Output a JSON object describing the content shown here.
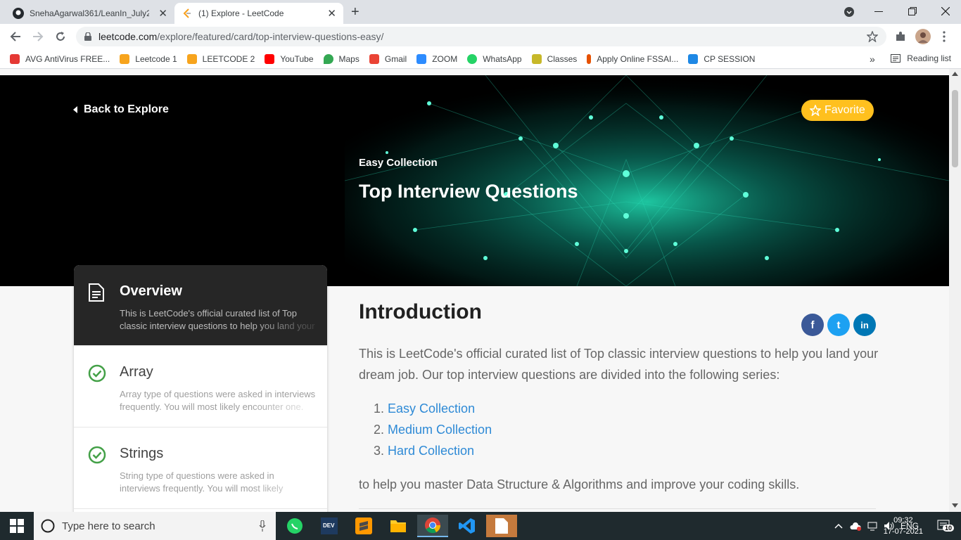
{
  "browser": {
    "tabs": [
      {
        "title": "SnehaAgarwal361/LeanIn_July20...",
        "close": "✕"
      },
      {
        "title": "(1) Explore - LeetCode",
        "close": "✕"
      }
    ],
    "new_tab": "+",
    "url_host": "leetcode.com",
    "url_path": "/explore/featured/card/top-interview-questions-easy/",
    "bookmarks": [
      {
        "label": "AVG AntiVirus FREE...",
        "color": "#e53935"
      },
      {
        "label": "Leetcode 1",
        "color": "#f7a41d"
      },
      {
        "label": "LEETCODE 2",
        "color": "#f7a41d"
      },
      {
        "label": "YouTube",
        "color": "#ff0000"
      },
      {
        "label": "Maps",
        "color": "#34a853"
      },
      {
        "label": "Gmail",
        "color": "#ea4335"
      },
      {
        "label": "ZOOM",
        "color": "#2d8cff"
      },
      {
        "label": "WhatsApp",
        "color": "#25d366"
      },
      {
        "label": "Classes",
        "color": "#c7b829"
      },
      {
        "label": "Apply Online FSSAI...",
        "color": "#e65100"
      },
      {
        "label": "CP SESSION",
        "color": "#1e88e5"
      }
    ],
    "more_bookmarks": "»",
    "reading_list": "Reading list"
  },
  "hero": {
    "back_label": "Back to Explore",
    "favorite_label": "Favorite",
    "subtitle": "Easy Collection",
    "title": "Top Interview Questions"
  },
  "chapters": [
    {
      "title": "Overview",
      "desc": "This is LeetCode's official curated list of Top classic interview questions to help you land your dream job.",
      "icon": "document-icon"
    },
    {
      "title": "Array",
      "desc": "Array type of questions were asked in interviews frequently. You will most likely encounter one.",
      "icon": "check-circle-icon"
    },
    {
      "title": "Strings",
      "desc": "String type of questions were asked in interviews frequently. You will most likely encounter one.",
      "icon": "check-circle-icon"
    }
  ],
  "main": {
    "heading": "Introduction",
    "paragraph": "This is LeetCode's official curated list of Top classic interview questions to help you land your dream job. Our top interview questions are divided into the following series:",
    "list": [
      "Easy Collection",
      "Medium Collection",
      "Hard Collection"
    ],
    "outro": "to help you master Data Structure & Algorithms and improve your coding skills.",
    "social": [
      {
        "name": "facebook",
        "glyph": "f",
        "color": "#3b5998"
      },
      {
        "name": "twitter",
        "glyph": "t",
        "color": "#1da1f2"
      },
      {
        "name": "linkedin",
        "glyph": "in",
        "color": "#0077b5"
      }
    ]
  },
  "taskbar": {
    "search_placeholder": "Type here to search",
    "lang": "ENG",
    "time": "09:32",
    "date": "17-07-2021",
    "notifications": "10"
  }
}
